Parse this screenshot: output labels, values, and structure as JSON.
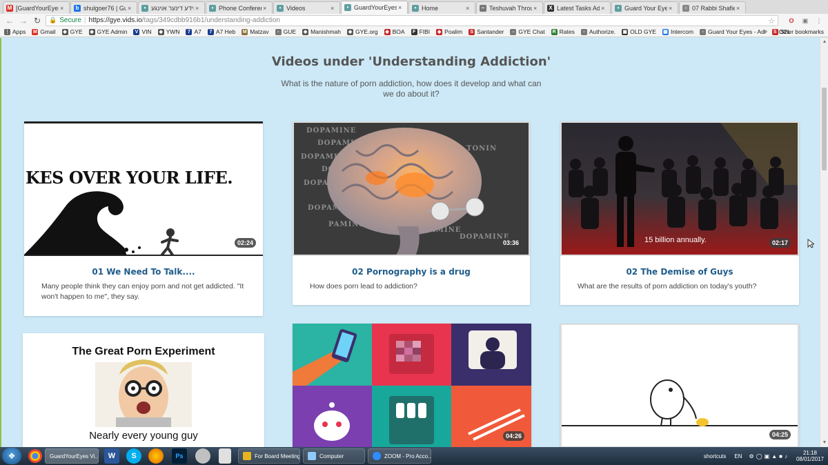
{
  "browser": {
    "tabs": [
      {
        "label": "[GuardYourEyes] |",
        "icon_color": "#d93025",
        "icon_glyph": "M",
        "active": false
      },
      {
        "label": "shulgoer76 | Gui",
        "icon_color": "#1a73e8",
        "icon_glyph": "b",
        "active": false
      },
      {
        "label": "ווידע דינער אוינגע",
        "icon_color": "#5f9ea0",
        "icon_glyph": "•",
        "active": false
      },
      {
        "label": "Phone Conferenc",
        "icon_color": "#5f9ea0",
        "icon_glyph": "•",
        "active": false
      },
      {
        "label": "Videos",
        "icon_color": "#5f9ea0",
        "icon_glyph": "•",
        "active": false
      },
      {
        "label": "GuardYourEyes V",
        "icon_color": "#5f9ea0",
        "icon_glyph": "•",
        "active": true
      },
      {
        "label": "Home",
        "icon_color": "#5f9ea0",
        "icon_glyph": "•",
        "active": false
      },
      {
        "label": "Teshuvah Throug",
        "icon_color": "#777777",
        "icon_glyph": "~",
        "active": false
      },
      {
        "label": "Latest Tasks Add",
        "icon_color": "#333333",
        "icon_glyph": "X",
        "active": false
      },
      {
        "label": "Guard Your Eyes",
        "icon_color": "#5f9ea0",
        "icon_glyph": "•",
        "active": false
      },
      {
        "label": "07 Rabbi Shafier",
        "icon_color": "#888888",
        "icon_glyph": "▫",
        "active": false
      }
    ],
    "address": {
      "secure_label": "Secure",
      "host": "https://gye.vids.io",
      "path": "/tags/349cdbb916b1/understanding-addiction"
    },
    "bookmarks": [
      {
        "label": "Apps",
        "color": "#666666",
        "glyph": "⋮"
      },
      {
        "label": "Gmail",
        "color": "#d93025",
        "glyph": "M"
      },
      {
        "label": "GYE",
        "color": "#555555",
        "glyph": "◆"
      },
      {
        "label": "GYE Admin",
        "color": "#555555",
        "glyph": "◆"
      },
      {
        "label": "VIN",
        "color": "#1a3d8f",
        "glyph": "V"
      },
      {
        "label": "YWN",
        "color": "#555555",
        "glyph": "◆"
      },
      {
        "label": "A7",
        "color": "#1a3d8f",
        "glyph": "7"
      },
      {
        "label": "A7 Heb",
        "color": "#1a3d8f",
        "glyph": "7"
      },
      {
        "label": "Matzav",
        "color": "#8a6d3b",
        "glyph": "M"
      },
      {
        "label": "GUE",
        "color": "#777777",
        "glyph": "▫"
      },
      {
        "label": "Manishmah",
        "color": "#555555",
        "glyph": "◆"
      },
      {
        "label": "GYE.org",
        "color": "#555555",
        "glyph": "◆"
      },
      {
        "label": "BOA",
        "color": "#c62828",
        "glyph": "◆"
      },
      {
        "label": "FIBI",
        "color": "#333333",
        "glyph": "F"
      },
      {
        "label": "Poalim",
        "color": "#c62828",
        "glyph": "◆"
      },
      {
        "label": "Santander",
        "color": "#c62828",
        "glyph": "S"
      },
      {
        "label": "GYE Chat",
        "color": "#777777",
        "glyph": "▫"
      },
      {
        "label": "Rates",
        "color": "#2e7d32",
        "glyph": "R"
      },
      {
        "label": "Authorize.",
        "color": "#777777",
        "glyph": "▫"
      },
      {
        "label": "OLD GYE",
        "color": "#333333",
        "glyph": "▣"
      },
      {
        "label": "Intercom",
        "color": "#1a73e8",
        "glyph": "▦"
      },
      {
        "label": "Guard Your Eyes - Adi",
        "color": "#777777",
        "glyph": "▫"
      },
      {
        "label": "S2L",
        "color": "#c62828",
        "glyph": "S"
      }
    ],
    "other_bookmarks": "Other bookmarks"
  },
  "page": {
    "title": "Videos under 'Understanding Addiction'",
    "subtitle": "What is the nature of porn addiction, how does it develop and what can we do about it?",
    "cards": [
      {
        "title": "01 We Need To Talk....",
        "description": "Many people think they can enjoy porn and not get addicted. \"It won't happen to me\", they say.",
        "duration": "02:24",
        "thumb_caption": "KES OVER YOUR LIFE."
      },
      {
        "title": "02 Pornography is a drug",
        "description": "How does porn lead to addiction?",
        "duration": "03:36",
        "thumb_words": [
          "DOPAMINE",
          "DOPAMINE",
          "DOPAMINE",
          "DOPAMINE",
          "DOPAMINE",
          "DOPAMINE",
          "PAMINE",
          "DOPAMINE",
          "TONIN",
          "DOPAMINE"
        ]
      },
      {
        "title": "02 The Demise of Guys",
        "description": "What are the results of porn addiction on today's youth?",
        "duration": "02:17",
        "thumb_subtitle": "15 billion annually."
      },
      {
        "thumb_heading": "The Great Porn Experiment",
        "thumb_footer": "Nearly every young guy"
      },
      {
        "duration": "04:26"
      },
      {
        "duration": "04:25"
      }
    ]
  },
  "taskbar": {
    "windows": [
      {
        "label": "GuardYourEyes Vi...",
        "color": "#4285f4"
      },
      {
        "label": "For Board Meeting",
        "color": "#e6b422"
      },
      {
        "label": "Computer",
        "color": "#90caf9"
      },
      {
        "label": "ZOOM - Pro Acco...",
        "color": "#2d8cff"
      }
    ],
    "tray_label": "shortcuts",
    "language": "EN",
    "time": "21:18",
    "date": "08/01/2017"
  }
}
